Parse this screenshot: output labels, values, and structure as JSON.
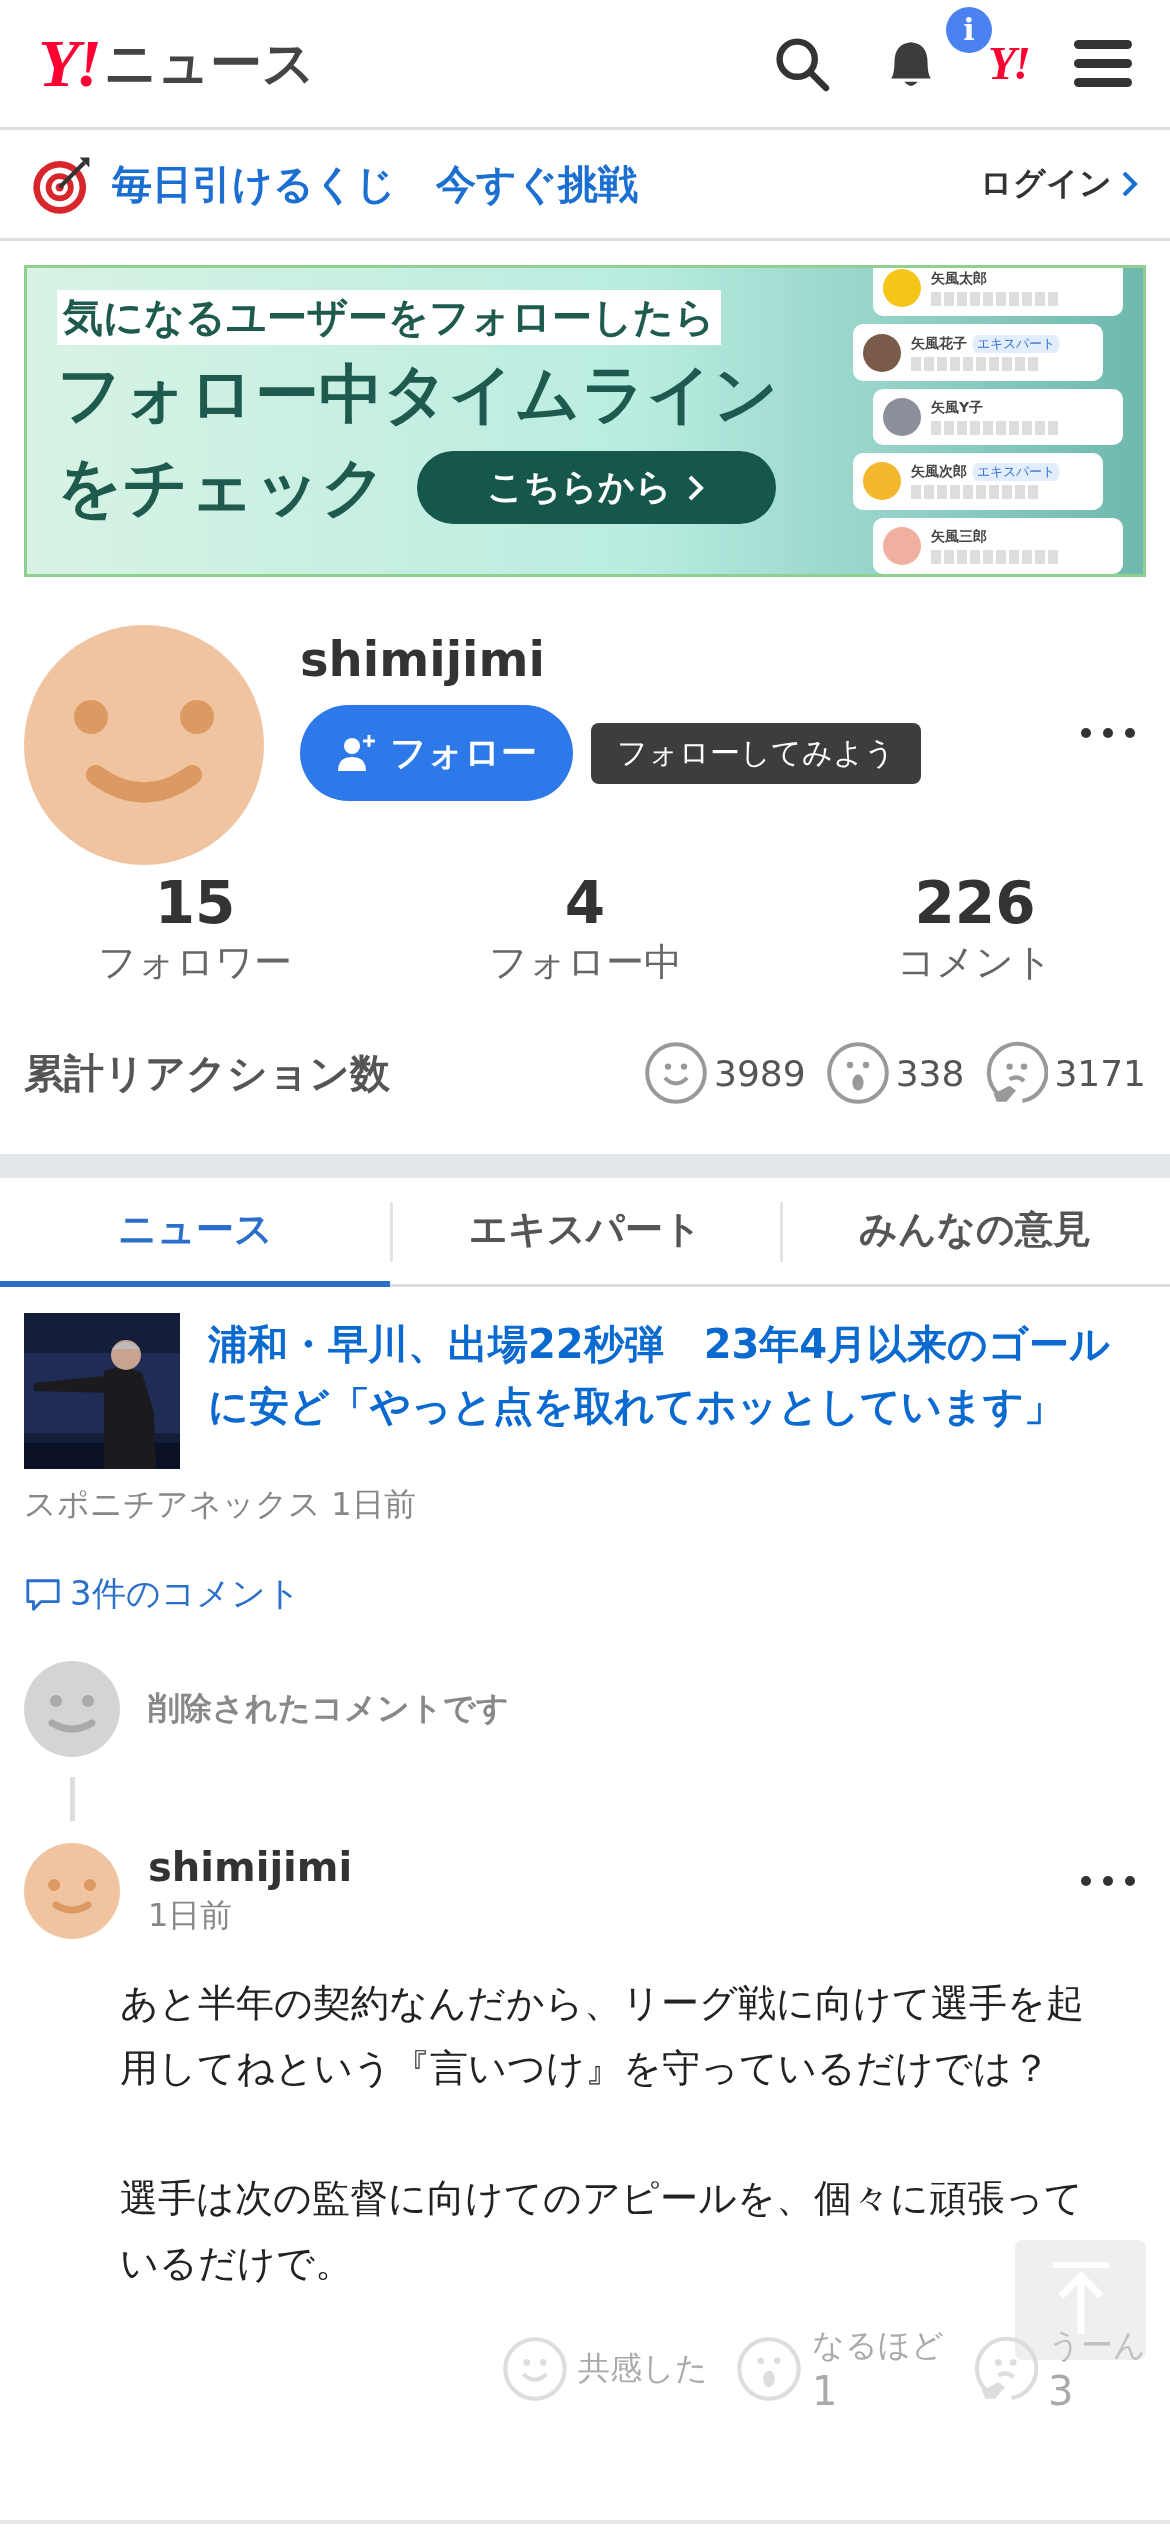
{
  "header": {
    "logo_mark": "Y!",
    "logo_text": "ニュース",
    "notification_badge": "i",
    "yahoo_link": "Y!"
  },
  "promo_bar": {
    "text": "毎日引けるくじ　今すぐ挑戦",
    "login": "ログイン"
  },
  "banner": {
    "line_1": "気になるユーザーをフォローしたら",
    "line_2": "フォロー中タイムライン",
    "line_3": "をチェック",
    "button": "こちらから",
    "cards": [
      {
        "name": "矢風太郎",
        "color": "#f5c518"
      },
      {
        "name": "矢風花子",
        "badge": "エキスパート",
        "color": "#7a5a48"
      },
      {
        "name": "矢風Y子",
        "color": "#8a8f99"
      },
      {
        "name": "矢風次郎",
        "badge": "エキスパート",
        "color": "#f3b82e"
      },
      {
        "name": "矢風三郎",
        "color": "#f0b0a0"
      }
    ]
  },
  "profile": {
    "username": "shimijimi",
    "follow_button": "フォロー",
    "tooltip": "フォローしてみよう"
  },
  "stats": [
    {
      "value": "15",
      "label": "フォロワー"
    },
    {
      "value": "4",
      "label": "フォロー中"
    },
    {
      "value": "226",
      "label": "コメント"
    }
  ],
  "reactions": {
    "label": "累計リアクション数",
    "items": [
      {
        "kind": "smile",
        "count": "3989"
      },
      {
        "kind": "wow",
        "count": "338"
      },
      {
        "kind": "hmm",
        "count": "3171"
      }
    ]
  },
  "tabs": [
    {
      "label": "ニュース",
      "selected": true
    },
    {
      "label": "エキスパート",
      "selected": false
    },
    {
      "label": "みんなの意見",
      "selected": false
    }
  ],
  "article": {
    "title": "浦和・早川、出場22秒弾　23年4月以来のゴールに安ど「やっと点を取れてホッとしています」",
    "source": "スポニチアネックス 1日前",
    "comments_link": "3件のコメント"
  },
  "deleted_comment": "削除されたコメントです",
  "comment": {
    "username": "shimijimi",
    "time": "1日前",
    "paragraphs": [
      "あと半年の契約なんだから、リーグ戦に向けて選手を起用してねという『言いつけ』を守っているだけでは？",
      "選手は次の監督に向けてのアピールを、個々に頑張っているだけで。"
    ],
    "reactions": [
      {
        "kind": "smile",
        "label": "共感した"
      },
      {
        "kind": "wow",
        "label": "なるほど",
        "count": "1"
      },
      {
        "kind": "hmm",
        "label": "うーん",
        "count": "3"
      }
    ]
  }
}
